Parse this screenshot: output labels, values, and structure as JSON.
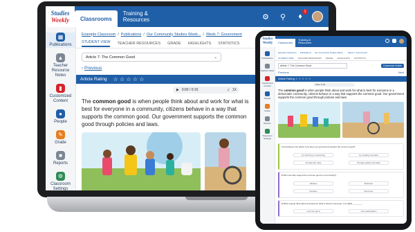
{
  "app": {
    "logo_line1": "Studies",
    "logo_line2": "Weekly",
    "tabs": [
      {
        "label": "Classrooms"
      },
      {
        "label": "Training & Resources"
      }
    ],
    "notification_count": "1"
  },
  "sidebar": {
    "items": [
      {
        "label": "Publications",
        "icon": "publications-icon",
        "color": "#1f5fa8"
      },
      {
        "label": "Teacher Resource Notes",
        "icon": "rocket-icon",
        "color": "#7c8794"
      },
      {
        "label": "Customized Content",
        "icon": "book-icon",
        "color": "#d6232a"
      },
      {
        "label": "People",
        "icon": "people-icon",
        "color": "#1f5fa8"
      },
      {
        "label": "Grade",
        "icon": "grade-icon",
        "color": "#e67e22"
      },
      {
        "label": "Reports",
        "icon": "reports-icon",
        "color": "#7c8794"
      },
      {
        "label": "Classroom Settings",
        "icon": "gear-icon",
        "color": "#2e8b57"
      }
    ]
  },
  "breadcrumb": [
    "Example Classroom",
    "Publications",
    "Our Community Studies Week...",
    "Week 7: Government"
  ],
  "content_tabs": [
    "STUDENT VIEW",
    "TEACHER RESOURCES",
    "GRADE",
    "HIGHLIGHTS",
    "STATISTICS"
  ],
  "article_select": "Article 7: The Common Good",
  "previous_label": "Previous",
  "rating_label": "Article Rating",
  "stars": "☆ ☆ ☆ ☆ ☆",
  "audio": {
    "time": "0:00 / 0:15",
    "speed": "1X"
  },
  "paragraph": {
    "lead": "The ",
    "term": "common good",
    "rest": " is when people think about and work for what is best for everyone in a community, citizens behave in a way that supports the common good. Our government supports the common good through policies and laws."
  },
  "tablet": {
    "logo": "Studies Weekly",
    "tabs": [
      "Classrooms",
      "Training & Resources"
    ],
    "sidebar": [
      "Publications",
      "Teacher Notes",
      "Customized Content",
      "People",
      "Grade",
      "Reports",
      "Classroom Settings"
    ],
    "article_select": "Article 7: The Common Good",
    "customize_btn": "Customize Article",
    "previous_label": "Previous",
    "next_label": "Next",
    "rating_label": "Article Rating",
    "paragraph_lead": "The ",
    "paragraph_term": "common good",
    "paragraph_rest": " is when people think about and work for what is best for everyone in a democratic community, citizens behave in a way that supports the common good. Our government supports the common good through policies and laws.",
    "questions": [
      {
        "num": "1",
        "text": "According to the article, how does our government support the common good?",
        "color": "#9bc53d",
        "opts": [
          "by enforcing or protecting",
          "by creating new laws",
          "through law rules",
          "through policies and laws"
        ]
      },
      {
        "num": "2",
        "text": "Who can help support the common good in a community?",
        "color": "#8e6cc4",
        "opts": [
          "Athletes",
          "Business",
          "Families",
          "Everyone"
        ]
      },
      {
        "num": "3",
        "text": "When people think about and work for what is best for everyone, it is called ________.",
        "color": "#8e6cc4",
        "opts": [
          "common good",
          "civic participation"
        ]
      }
    ]
  }
}
